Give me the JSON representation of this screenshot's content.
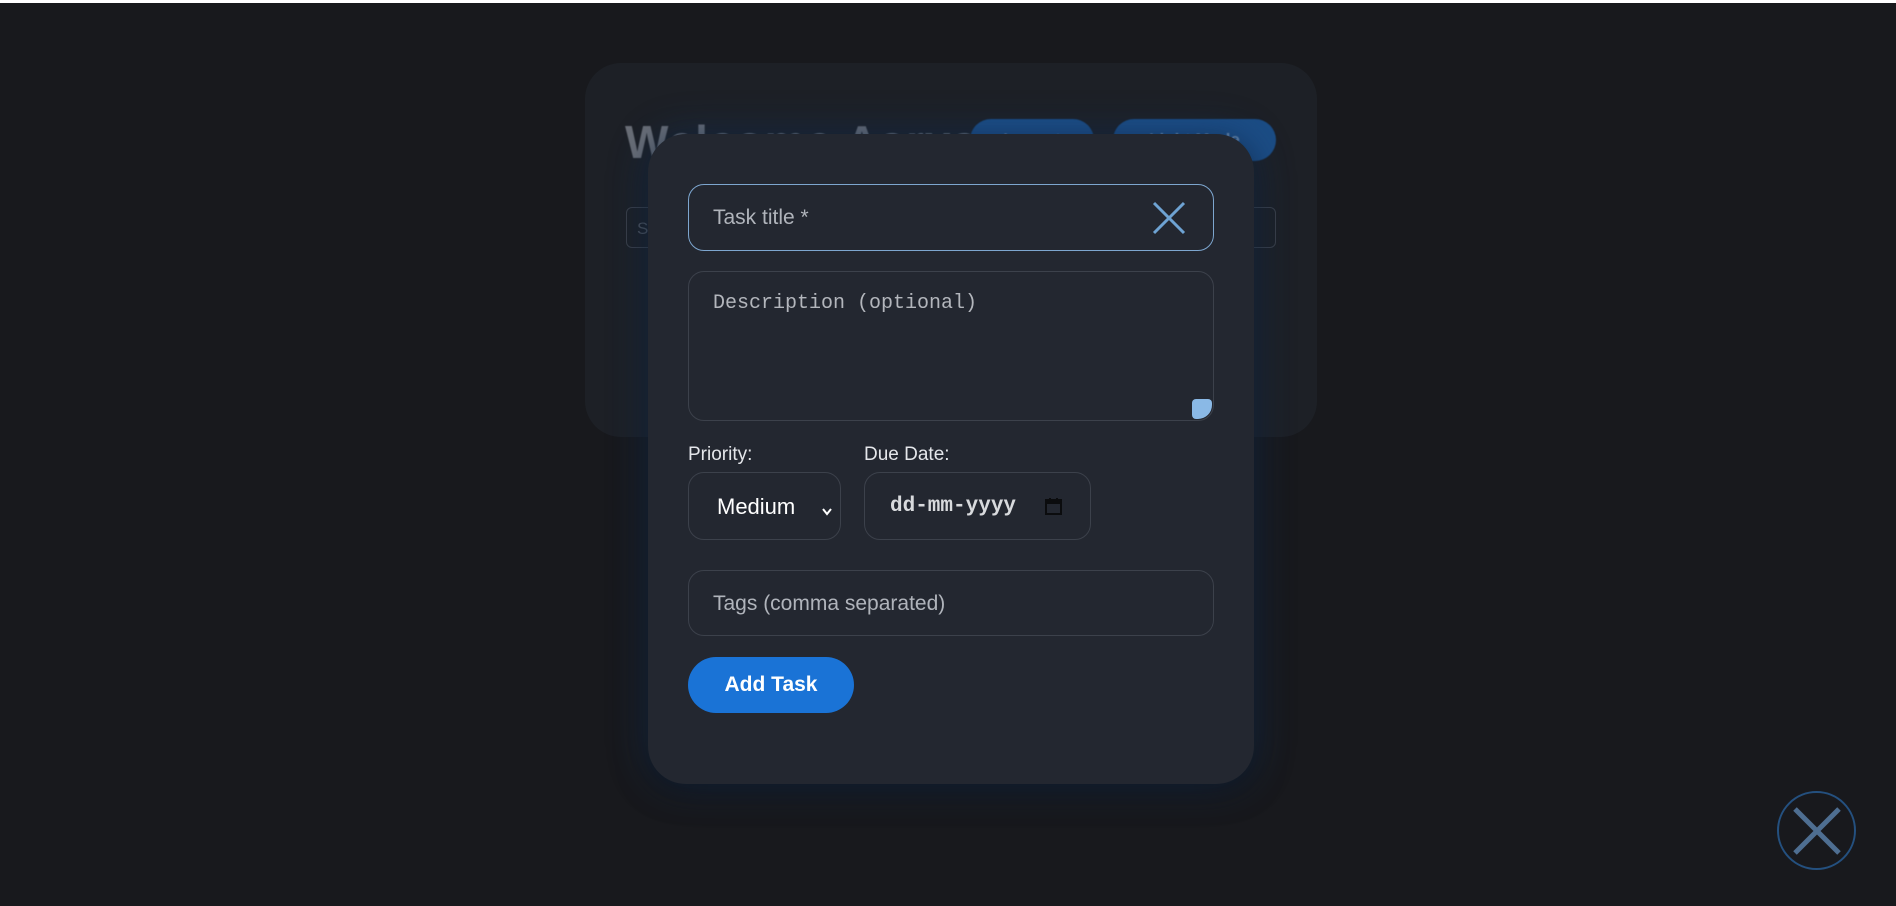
{
  "background": {
    "title": "Welcome Aaryan",
    "buttons": [
      "Logout",
      "Light Mode"
    ],
    "search_placeholder": "S"
  },
  "modal": {
    "title_placeholder": "Task title *",
    "description_placeholder": "Description (optional)",
    "priority_label": "Priority:",
    "priority_value": "Medium",
    "due_date_label": "Due Date:",
    "due_date_placeholder": "dd-mm-yyyy",
    "tags_placeholder": "Tags (comma separated)",
    "add_button": "Add Task"
  },
  "icons": {
    "clear": "close-icon",
    "calendar": "calendar-icon",
    "select": "chevron-down-icon",
    "floating_close": "close-icon"
  },
  "colors": {
    "accent": "#1a73d6",
    "background": "#18191d",
    "modal": "#232730",
    "focus_border": "#7da6cf"
  }
}
